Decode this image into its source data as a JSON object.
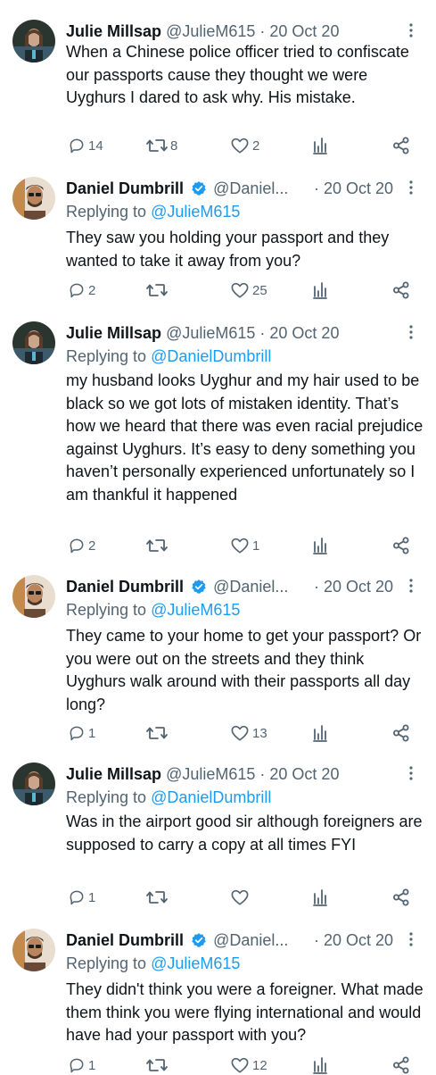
{
  "tweets": [
    {
      "name": "Julie Millsap",
      "handle": "@JulieM615",
      "date": "· 20 Oct 20",
      "verified": false,
      "replying_to": "",
      "text": "When a Chinese police officer tried to confiscate our passports cause they thought we were Uyghurs I dared to ask why. His mistake.",
      "replies": "14",
      "retweets": "8",
      "likes": "2"
    },
    {
      "name": "Daniel Dumbrill",
      "handle": "@Daniel...",
      "date": "· 20 Oct 20",
      "verified": true,
      "replying_prefix": "Replying to",
      "replying_to": "@JulieM615",
      "text": "They saw you holding your passport and they wanted to take it away from you?",
      "replies": "2",
      "retweets": "",
      "likes": "25"
    },
    {
      "name": "Julie Millsap",
      "handle": "@JulieM615",
      "date": "· 20 Oct 20",
      "verified": false,
      "replying_prefix": "Replying to",
      "replying_to": "@DanielDumbrill",
      "text": "my husband looks Uyghur and my hair used to be black so we got lots of mistaken identity. That’s how we heard that there was even racial prejudice against Uyghurs. It’s easy to deny something you haven’t personally experienced unfortunately so I am thankful it happened",
      "replies": "2",
      "retweets": "",
      "likes": "1"
    },
    {
      "name": "Daniel Dumbrill",
      "handle": "@Daniel...",
      "date": "· 20 Oct 20",
      "verified": true,
      "replying_prefix": "Replying to",
      "replying_to": "@JulieM615",
      "text": "They came to your home to get your passport?  Or you were out on the streets and they think Uyghurs walk around with their passports all day long?",
      "replies": "1",
      "retweets": "",
      "likes": "13"
    },
    {
      "name": "Julie Millsap",
      "handle": "@JulieM615",
      "date": "· 20 Oct 20",
      "verified": false,
      "replying_prefix": "Replying to",
      "replying_to": "@DanielDumbrill",
      "text": "Was in the airport good sir although foreigners are supposed to carry a copy at all times FYI",
      "replies": "1",
      "retweets": "",
      "likes": ""
    },
    {
      "name": "Daniel Dumbrill",
      "handle": "@Daniel...",
      "date": "· 20 Oct 20",
      "verified": true,
      "replying_prefix": "Replying to",
      "replying_to": "@JulieM615",
      "text": "They didn't think you were a foreigner.  What made them think you were flying international and would have had your passport with you?",
      "replies": "1",
      "retweets": "",
      "likes": "12"
    }
  ],
  "icons": {
    "reply": "reply-icon",
    "retweet": "retweet-icon",
    "like": "heart-icon",
    "views": "analytics-icon",
    "share": "share-icon",
    "more": "more-vertical-icon",
    "verified": "verified-badge-icon"
  },
  "colors": {
    "text": "#0f1419",
    "secondary": "#536471",
    "link": "#1d9bf0",
    "thread_line": "#cfd9de"
  }
}
